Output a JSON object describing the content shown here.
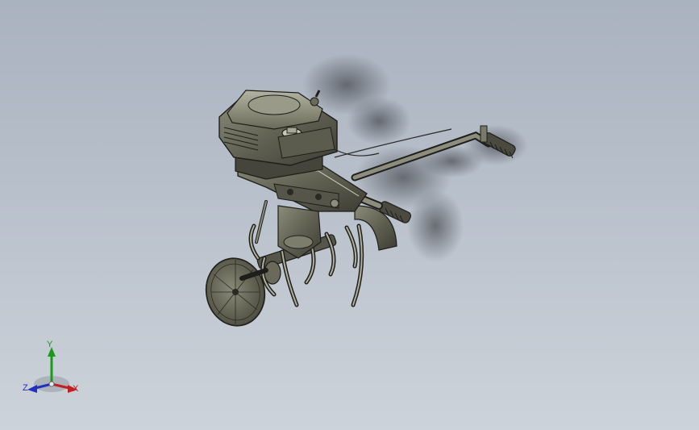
{
  "window": {
    "title": ""
  },
  "colors": {
    "background_top": "#a9b2bf",
    "background_bottom": "#cdd3da",
    "model_metal": "#6b6b5c",
    "model_edge": "#1e1e1a",
    "axis_x": "#c02020",
    "axis_y": "#1a9a1a",
    "axis_z": "#2030c0"
  },
  "model": {
    "icon": "tiller-cultivator-model"
  },
  "triad": {
    "x_label": "X",
    "y_label": "Y",
    "z_label": "Z"
  }
}
